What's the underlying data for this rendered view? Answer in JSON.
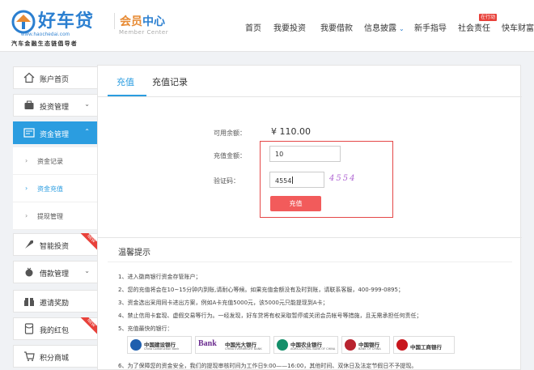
{
  "header": {
    "logo_text": "好车贷",
    "logo_url": "www.haochedai.com",
    "logo_slogan": "汽车金融生态链倡导者",
    "member_center_a": "会员",
    "member_center_b": "中心",
    "member_center_en": "Member Center",
    "nav": [
      {
        "label": "首页"
      },
      {
        "label": "我要投资"
      },
      {
        "label": "我要借款"
      },
      {
        "label": "信息披露"
      },
      {
        "label": "新手指导"
      },
      {
        "label": "社会责任"
      },
      {
        "label": "快车财富"
      }
    ],
    "hot_badge": "在行动"
  },
  "sidebar": {
    "items": [
      {
        "label": "账户首页",
        "icon": "home-icon"
      },
      {
        "label": "投资管理",
        "icon": "invest-icon"
      },
      {
        "label": "资金管理",
        "icon": "funds-icon"
      },
      {
        "label": "智能投资",
        "icon": "rocket-icon",
        "badge": "NEW"
      },
      {
        "label": "借款管理",
        "icon": "loan-icon"
      },
      {
        "label": "邀请奖励",
        "icon": "invite-icon"
      },
      {
        "label": "我的红包",
        "icon": "red-packet-icon",
        "badge": "NEW"
      },
      {
        "label": "积分商城",
        "icon": "cart-icon"
      }
    ],
    "sub_items": [
      {
        "label": "资金记录"
      },
      {
        "label": "资金充值"
      },
      {
        "label": "提现管理"
      }
    ]
  },
  "tabs": [
    {
      "label": "充值"
    },
    {
      "label": "充值记录"
    }
  ],
  "form": {
    "balance_label": "可用余额：",
    "balance_value": "¥ 110.00",
    "amount_label": "充值金额：",
    "amount_value": "10",
    "code_label": "验证码：",
    "code_value": "4554",
    "captcha": "4554",
    "submit_label": "充值"
  },
  "tips": {
    "title": "温馨提示",
    "lines": [
      "1、进入徽商银行资金存管账户；",
      "2、您的充值将会在10~15分钟内到账,请耐心等候。如果充值金额没有及时到账，请联系客服，400-999-0895；",
      "3、资金选出采用同卡进出方案，例如A卡充值5000元，该5000元只能提现到A卡；",
      "4、禁止信用卡套现、虚假交易等行为。一经发现，好车贷将有权采取暂停或关闭会员帐号等措施，且无需承担任何责任；",
      "5、充值最快的银行：",
      "6、为了保障您的资金安全，我们的提现审核时间为工作日9:00——16:00，其他时间、双休日及法定节假日不予提现。"
    ],
    "banks": [
      {
        "name": "中国建设银行",
        "en": "China Construction Bank",
        "color": "#1f5fae"
      },
      {
        "name": "中国光大银行",
        "en": "CHINA EVERBRIGHT BANK",
        "color": "#6b2c8f",
        "prefix": "Bank"
      },
      {
        "name": "中国农业银行",
        "en": "AGRICULTURAL BANK OF CHINA",
        "color": "#148f6a"
      },
      {
        "name": "中国银行",
        "en": "BANK OF CHINA",
        "color": "#b8232f"
      },
      {
        "name": "中国工商银行",
        "en": "",
        "color": "#c8161d"
      }
    ]
  }
}
